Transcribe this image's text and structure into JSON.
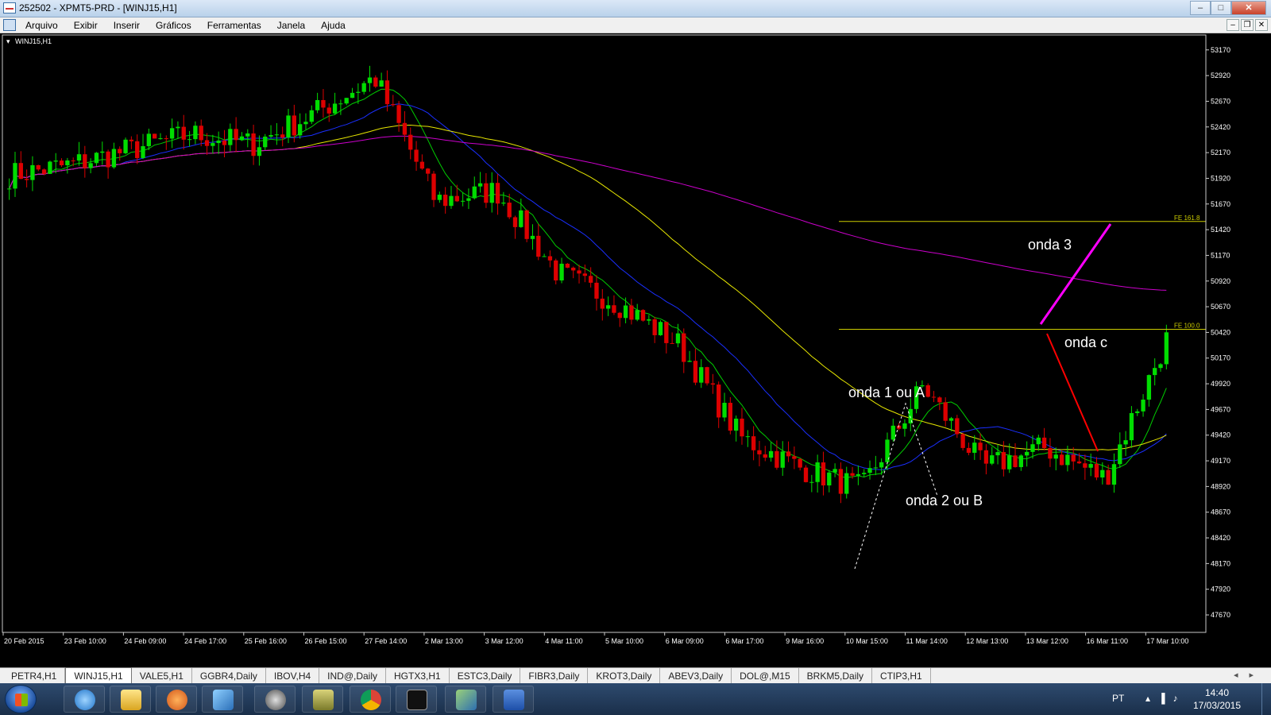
{
  "window": {
    "title": "252502 - XPMT5-PRD - [WINJ15,H1]"
  },
  "menu": [
    "Arquivo",
    "Exibir",
    "Inserir",
    "Gráficos",
    "Ferramentas",
    "Janela",
    "Ajuda"
  ],
  "chart": {
    "symbol_label": "WINJ15,H1",
    "price_levels": [
      "53170",
      "52920",
      "52670",
      "52420",
      "52170",
      "51920",
      "51670",
      "51420",
      "51170",
      "50920",
      "50670",
      "50420",
      "50170",
      "49920",
      "49670",
      "49420",
      "49170",
      "48920",
      "48670",
      "48420",
      "48170",
      "47920",
      "47670"
    ],
    "time_labels": [
      "20 Feb 2015",
      "23 Feb 10:00",
      "24 Feb 09:00",
      "24 Feb 17:00",
      "25 Feb 16:00",
      "26 Feb 15:00",
      "27 Feb 14:00",
      "2 Mar 13:00",
      "3 Mar 12:00",
      "4 Mar 11:00",
      "5 Mar 10:00",
      "6 Mar 09:00",
      "6 Mar 17:00",
      "9 Mar 16:00",
      "10 Mar 15:00",
      "11 Mar 14:00",
      "12 Mar 13:00",
      "13 Mar 12:00",
      "16 Mar 11:00",
      "17 Mar 10:00"
    ],
    "fib_levels": [
      {
        "label": "FE 161.8",
        "price": 51500
      },
      {
        "label": "FE 100.0",
        "price": 50450
      }
    ],
    "annotations": {
      "wave3": "onda 3",
      "wavec": "onda c",
      "wave1": "onda 1 ou A",
      "wave2": "onda 2 ou B"
    },
    "colors": {
      "background": "#000000",
      "bull": "#00dd00",
      "bear": "#dd0000",
      "ma_fast": "#00cc00",
      "ma_mid": "#1a2fff",
      "ma_slow": "#e6e600",
      "ma_long": "#cc00cc",
      "fib": "#cccc00",
      "wave3_line": "#ff00ff",
      "wavec_line": "#ff0000"
    },
    "chart_data": {
      "type": "candlestick",
      "title": "WINJ15,H1",
      "ylim": [
        47500,
        53300
      ],
      "x": [
        "20 Feb 2015",
        "23 Feb 10:00",
        "24 Feb 09:00",
        "24 Feb 17:00",
        "25 Feb 16:00",
        "26 Feb 15:00",
        "27 Feb 14:00",
        "2 Mar 13:00",
        "3 Mar 12:00",
        "4 Mar 11:00",
        "5 Mar 10:00",
        "6 Mar 09:00",
        "6 Mar 17:00",
        "9 Mar 16:00",
        "10 Mar 15:00",
        "11 Mar 14:00",
        "12 Mar 13:00",
        "13 Mar 12:00",
        "16 Mar 11:00",
        "17 Mar 10:00"
      ],
      "close_path": [
        51950,
        52050,
        52200,
        52350,
        52250,
        52550,
        52900,
        51700,
        51800,
        51000,
        50700,
        50300,
        49400,
        49100,
        48900,
        49900,
        49100,
        49300,
        49000,
        50350
      ]
    }
  },
  "symbol_tabs": [
    "PETR4,H1",
    "WINJ15,H1",
    "VALE5,H1",
    "GGBR4,Daily",
    "IBOV,H4",
    "IND@,Daily",
    "HGTX3,H1",
    "ESTC3,Daily",
    "FIBR3,Daily",
    "KROT3,Daily",
    "ABEV3,Daily",
    "DOL@,M15",
    "BRKM5,Daily",
    "CTIP3,H1"
  ],
  "active_tab": "WINJ15,H1",
  "taskbar": {
    "lang": "PT",
    "time": "14:40",
    "date": "17/03/2015",
    "apps": [
      "ie-icon",
      "folder-icon",
      "media-player-icon",
      "remote-desktop-icon",
      "hp-icon",
      "tools-icon",
      "chrome-icon",
      "xp-icon",
      "mt5-icon",
      "word-icon"
    ]
  }
}
